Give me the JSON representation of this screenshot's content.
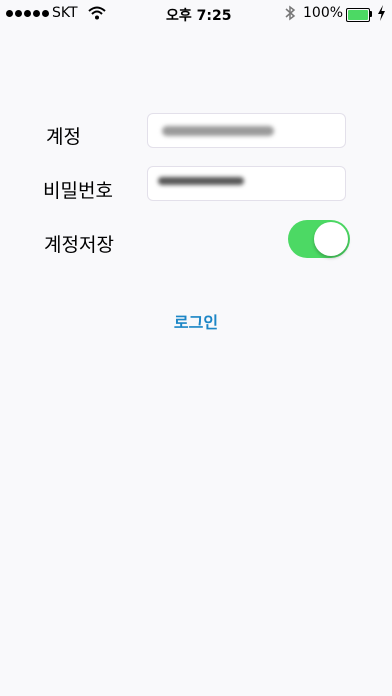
{
  "status_bar": {
    "carrier": "SKT",
    "time": "오후 7:25",
    "battery_percent": "100%",
    "battery_level": 1.0,
    "battery_color": "#4cd964"
  },
  "form": {
    "account_label": "계정",
    "password_label": "비밀번호",
    "save_account_label": "계정저장",
    "save_account_on": true,
    "toggle_color": "#4cd964"
  },
  "actions": {
    "login_label": "로그인",
    "login_color": "#1c86c6"
  }
}
